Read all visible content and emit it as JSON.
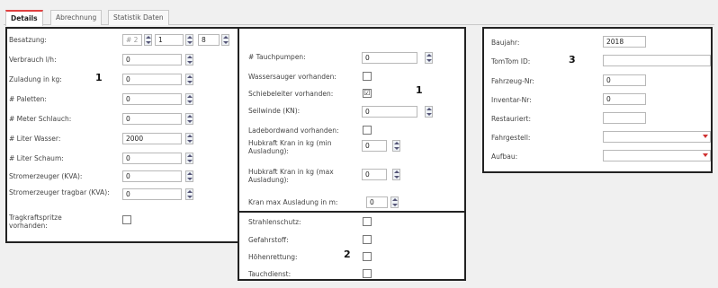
{
  "tabs": [
    {
      "label": "Details"
    },
    {
      "label": "Abrechnung"
    },
    {
      "label": "Statistik Daten"
    }
  ],
  "panel1": {
    "marker": "1",
    "besatzung": {
      "label": "Besatzung:",
      "v1": "# 2",
      "v2": "1",
      "v3": "8"
    },
    "fields": [
      {
        "label": "Verbrauch l/h:",
        "value": "0"
      },
      {
        "label": "Zuladung in kg:",
        "value": "0"
      },
      {
        "label": "# Paletten:",
        "value": "0"
      },
      {
        "label": "# Meter Schlauch:",
        "value": "0"
      },
      {
        "label": "# Liter Wasser:",
        "value": "2000"
      },
      {
        "label": "# Liter Schaum:",
        "value": "0"
      },
      {
        "label": "Stromerzeuger (KVA):",
        "value": "0"
      },
      {
        "label": "Stromerzeuger tragbar (KVA):",
        "value": "0"
      }
    ],
    "tragkraft": {
      "label": "Tragkraftspritze vorhanden:",
      "checked": ""
    }
  },
  "panel2": {
    "marker": "1",
    "tauchpumpen": {
      "label": "# Tauchpumpen:",
      "value": "0"
    },
    "wassersauger": {
      "label": "Wassersauger vorhanden:",
      "checked": ""
    },
    "schiebeleiter": {
      "label": "Schiebeleiter vorhanden:",
      "checked": "☑"
    },
    "seilwinde": {
      "label": "Seilwinde (KN):",
      "value": "0"
    },
    "ladebordwand": {
      "label": "Ladebordwand vorhanden:",
      "checked": ""
    },
    "hubkraft_min": {
      "label": "Hubkraft Kran in kg (min Ausladung):",
      "value": "0"
    },
    "hubkraft_max": {
      "label": "Hubkraft Kran in kg (max Ausladung):",
      "value": "0"
    },
    "kran_max": {
      "label": "Kran max Ausladung in m:",
      "value": "0"
    }
  },
  "panel3": {
    "marker": "2",
    "items": [
      {
        "label": "Strahlenschutz:"
      },
      {
        "label": "Gefahrstoff:"
      },
      {
        "label": "Höhenrettung:"
      },
      {
        "label": "Tauchdienst:"
      }
    ]
  },
  "panel4": {
    "marker": "3",
    "baujahr": {
      "label": "Baujahr:",
      "value": "2018"
    },
    "tomtom": {
      "label": "TomTom ID:",
      "value": ""
    },
    "fahrzeug_nr": {
      "label": "Fahrzeug-Nr:",
      "value": "0"
    },
    "inventar_nr": {
      "label": "Inventar-Nr:",
      "value": "0"
    },
    "restaurant": {
      "label": "Restauriert:",
      "value": ""
    },
    "fahrgestell": {
      "label": "Fahrgestell:",
      "value": ""
    },
    "aufbau": {
      "label": "Aufbau:",
      "value": ""
    }
  }
}
